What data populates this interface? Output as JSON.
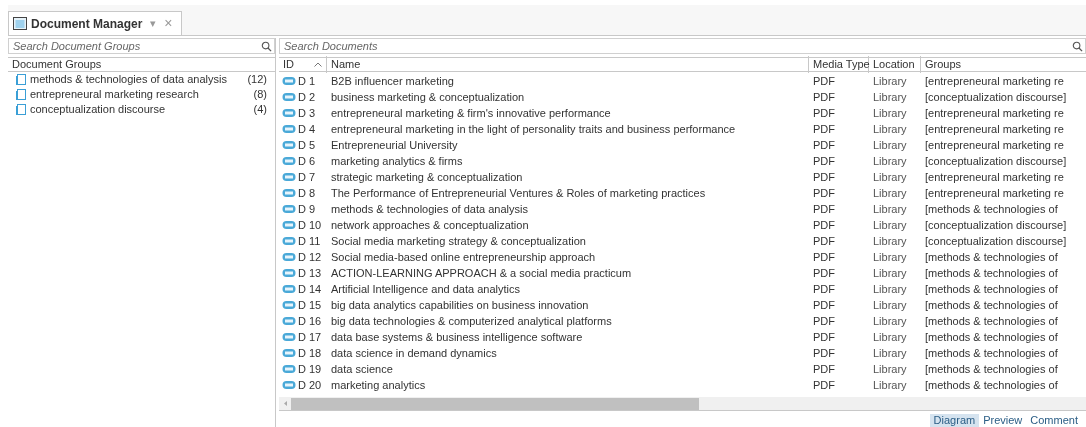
{
  "tab": {
    "title": "Document Manager",
    "dropdown": "▾",
    "close": "×"
  },
  "groups_panel": {
    "search": {
      "placeholder": "Search Document Groups"
    },
    "header": "Document Groups",
    "items": [
      {
        "name": "methods & technologies of data analysis",
        "count": "(12)"
      },
      {
        "name": "entrepreneural marketing research",
        "count": "(8)"
      },
      {
        "name": "conceptualization discourse",
        "count": "(4)"
      }
    ]
  },
  "documents": {
    "search": {
      "placeholder": "Search Documents"
    },
    "columns": [
      "ID",
      "Name",
      "Media Type",
      "Location",
      "Groups"
    ],
    "rows": [
      {
        "id": "D 1",
        "name": "B2B influencer marketing",
        "media": "PDF",
        "location": "Library",
        "groups": "[entrepreneural marketing re"
      },
      {
        "id": "D 2",
        "name": "business marketing & conceptualization",
        "media": "PDF",
        "location": "Library",
        "groups": "[conceptualization discourse]"
      },
      {
        "id": "D 3",
        "name": "entrepreneural marketing & firm's innovative performance",
        "media": "PDF",
        "location": "Library",
        "groups": "[entrepreneural marketing re"
      },
      {
        "id": "D 4",
        "name": "entrepreneural marketing in the light of personality traits and business performance",
        "media": "PDF",
        "location": "Library",
        "groups": "[entrepreneural marketing re"
      },
      {
        "id": "D 5",
        "name": "Entrepreneurial University",
        "media": "PDF",
        "location": "Library",
        "groups": "[entrepreneural marketing re"
      },
      {
        "id": "D 6",
        "name": "marketing analytics & firms",
        "media": "PDF",
        "location": "Library",
        "groups": "[conceptualization discourse]"
      },
      {
        "id": "D 7",
        "name": "strategic marketing & conceptualization",
        "media": "PDF",
        "location": "Library",
        "groups": "[entrepreneural marketing re"
      },
      {
        "id": "D 8",
        "name": "The Performance of Entrepreneurial Ventures & Roles of marketing practices",
        "media": "PDF",
        "location": "Library",
        "groups": "[entrepreneural marketing re"
      },
      {
        "id": "D 9",
        "name": "methods & technologies of data analysis",
        "media": "PDF",
        "location": "Library",
        "groups": "[methods & technologies of"
      },
      {
        "id": "D 10",
        "name": "network approaches & conceptualization",
        "media": "PDF",
        "location": "Library",
        "groups": "[conceptualization discourse]"
      },
      {
        "id": "D 11",
        "name": "Social media marketing strategy & conceptualization",
        "media": "PDF",
        "location": "Library",
        "groups": "[conceptualization discourse]"
      },
      {
        "id": "D 12",
        "name": "Social media-based online entrepreneurship approach",
        "media": "PDF",
        "location": "Library",
        "groups": "[methods & technologies of"
      },
      {
        "id": "D 13",
        "name": "ACTION-LEARNING APPROACH & a social media practicum",
        "media": "PDF",
        "location": "Library",
        "groups": "[methods & technologies of"
      },
      {
        "id": "D 14",
        "name": "Artificial Intelligence and data analytics",
        "media": "PDF",
        "location": "Library",
        "groups": "[methods & technologies of"
      },
      {
        "id": "D 15",
        "name": "big data analytics capabilities on business innovation",
        "media": "PDF",
        "location": "Library",
        "groups": "[methods & technologies of"
      },
      {
        "id": "D 16",
        "name": "big data technologies & computerized analytical platforms",
        "media": "PDF",
        "location": "Library",
        "groups": "[methods & technologies of"
      },
      {
        "id": "D 17",
        "name": "data base systems & business intelligence software",
        "media": "PDF",
        "location": "Library",
        "groups": "[methods & technologies of"
      },
      {
        "id": "D 18",
        "name": "data science in demand dynamics",
        "media": "PDF",
        "location": "Library",
        "groups": "[methods & technologies of"
      },
      {
        "id": "D 19",
        "name": "data science",
        "media": "PDF",
        "location": "Library",
        "groups": "[methods & technologies of"
      },
      {
        "id": "D 20",
        "name": "marketing analytics",
        "media": "PDF",
        "location": "Library",
        "groups": "[methods & technologies of"
      }
    ]
  },
  "bottom_tabs": [
    {
      "label": "Diagram",
      "selected": true
    },
    {
      "label": "Preview",
      "selected": false
    },
    {
      "label": "Comment",
      "selected": false
    }
  ]
}
